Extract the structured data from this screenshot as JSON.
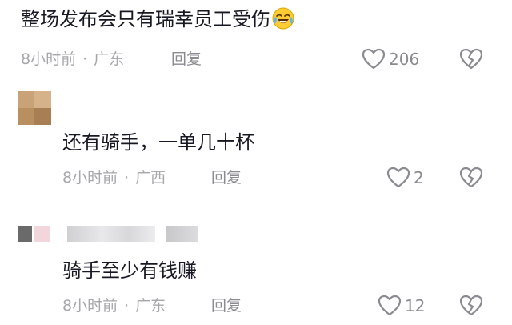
{
  "comments": [
    {
      "text": "整场发布会只有瑞幸员工受伤",
      "emoji": "crying-laughing-emoji-icon",
      "time": "8小时前",
      "separator": "·",
      "location": "广东",
      "reply_label": "回复",
      "likes": "206"
    },
    {
      "text": "还有骑手，一单几十杯",
      "time": "8小时前",
      "separator": "·",
      "location": "广西",
      "reply_label": "回复",
      "likes": "2"
    },
    {
      "text": "骑手至少有钱赚",
      "time": "8小时前",
      "separator": "·",
      "location": "广东",
      "reply_label": "回复",
      "likes": "12"
    }
  ],
  "colors": {
    "text": "#161823",
    "meta": "#a6a7ab",
    "icon": "#8a8b91"
  }
}
